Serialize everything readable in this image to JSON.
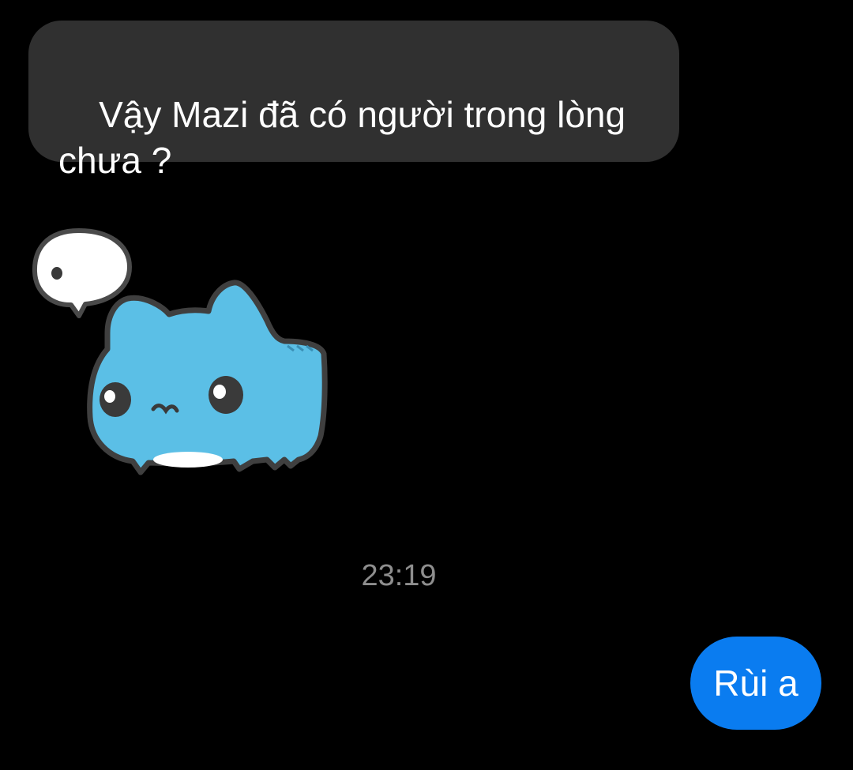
{
  "conversation": {
    "incoming_message": {
      "text": "Vậy Mazi đã có người trong lòng chưa ?",
      "bubble_color": "#303030",
      "text_color": "#ffffff"
    },
    "sticker": {
      "icon": "blue-cat-sticker-with-speech-bubble-icon",
      "body_color": "#5bbfe6"
    },
    "timestamp": "23:19",
    "outgoing_message": {
      "text": "Rùi a",
      "bubble_color": "#0a7cf0",
      "text_color": "#ffffff"
    }
  },
  "background_color": "#000000"
}
